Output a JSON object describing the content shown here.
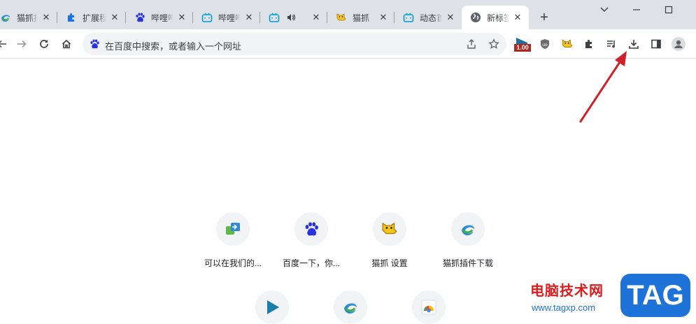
{
  "tabs": [
    {
      "title": "猫抓插件下载",
      "icon": "spiral-icon",
      "active": false
    },
    {
      "title": "扩展程序",
      "icon": "puzzle-icon",
      "active": false
    },
    {
      "title": "哔哩哔哩",
      "icon": "baidu-paw-icon",
      "active": false
    },
    {
      "title": "哔哩哔哩",
      "icon": "bilibili-icon",
      "active": false
    },
    {
      "title": "",
      "icon": "bilibili-icon",
      "audio_icon": "speaker-icon",
      "active": false
    },
    {
      "title": "猫抓",
      "icon": "cat-icon",
      "active": false
    },
    {
      "title": "动态首页",
      "icon": "bilibili-icon",
      "active": false
    },
    {
      "title": "新标签页",
      "icon": "globe-icon",
      "active": true
    }
  ],
  "omnibox": {
    "placeholder": "在百度中搜索，或者输入一个网址"
  },
  "extension_badge": "1.00",
  "shortcuts": [
    {
      "label": "可以在我们的...",
      "icon": "arrow-box-icon"
    },
    {
      "label": "百度一下，你...",
      "icon": "baidu-paw-icon"
    },
    {
      "label": "猫抓 设置",
      "icon": "cat-icon"
    },
    {
      "label": "猫抓插件下载",
      "icon": "spiral-icon"
    }
  ],
  "shortcuts_row2": [
    {
      "icon": "play-icon"
    },
    {
      "icon": "spiral-icon"
    },
    {
      "icon": "chrome-icon"
    }
  ],
  "watermark": {
    "text": "电脑技术网",
    "url": "www.tagxp.com",
    "tag": "TAG"
  },
  "colors": {
    "annotation_arrow": "#d0202a",
    "tabbar_bg": "#dee1e6",
    "watermark_red": "#e01c1c",
    "watermark_blue": "#1e73d8"
  }
}
